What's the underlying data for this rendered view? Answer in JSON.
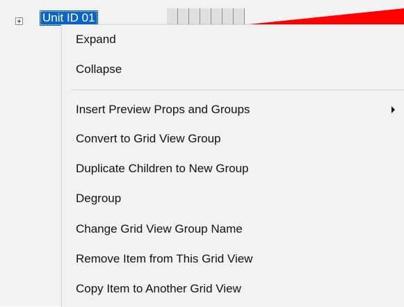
{
  "tree": {
    "node_label": "Unit ID 01"
  },
  "colors": {
    "selection": "#0a64c8",
    "timeline_fill": "#ff0000",
    "menu_bg": "#f2f2f2"
  },
  "context_menu": {
    "items": [
      {
        "label": "Expand"
      },
      {
        "label": "Collapse"
      },
      {
        "label": "Insert Preview Props and Groups",
        "has_submenu": true
      },
      {
        "label": "Convert to Grid View Group"
      },
      {
        "label": "Duplicate Children to New Group"
      },
      {
        "label": "Degroup"
      },
      {
        "label": "Change Grid View Group Name"
      },
      {
        "label": "Remove Item from This Grid View"
      },
      {
        "label": "Copy Item to Another Grid View"
      }
    ]
  }
}
